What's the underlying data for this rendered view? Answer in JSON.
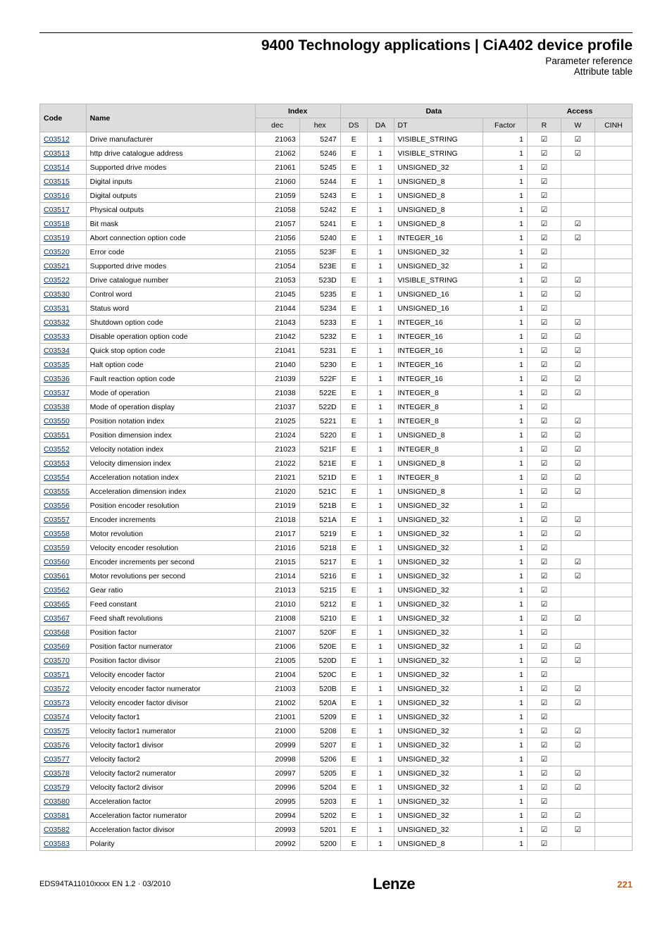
{
  "header": {
    "title": "9400 Technology applications | CiA402 device profile",
    "sub1": "Parameter reference",
    "sub2": "Attribute table"
  },
  "table": {
    "head": {
      "code": "Code",
      "name": "Name",
      "index_group": "Index",
      "data_group": "Data",
      "access_group": "Access",
      "dec": "dec",
      "hex": "hex",
      "ds": "DS",
      "da": "DA",
      "dt": "DT",
      "factor": "Factor",
      "r": "R",
      "w": "W",
      "cinh": "CINH"
    },
    "rows": [
      {
        "code": "C03512",
        "name": "Drive manufacturer",
        "dec": "21063",
        "hex": "5247",
        "ds": "E",
        "da": "1",
        "dt": "VISIBLE_STRING",
        "factor": "1",
        "r": true,
        "w": true,
        "cinh": false
      },
      {
        "code": "C03513",
        "name": "http drive catalogue address",
        "dec": "21062",
        "hex": "5246",
        "ds": "E",
        "da": "1",
        "dt": "VISIBLE_STRING",
        "factor": "1",
        "r": true,
        "w": true,
        "cinh": false
      },
      {
        "code": "C03514",
        "name": "Supported drive modes",
        "dec": "21061",
        "hex": "5245",
        "ds": "E",
        "da": "1",
        "dt": "UNSIGNED_32",
        "factor": "1",
        "r": true,
        "w": false,
        "cinh": false
      },
      {
        "code": "C03515",
        "name": "Digital inputs",
        "dec": "21060",
        "hex": "5244",
        "ds": "E",
        "da": "1",
        "dt": "UNSIGNED_8",
        "factor": "1",
        "r": true,
        "w": false,
        "cinh": false
      },
      {
        "code": "C03516",
        "name": "Digital outputs",
        "dec": "21059",
        "hex": "5243",
        "ds": "E",
        "da": "1",
        "dt": "UNSIGNED_8",
        "factor": "1",
        "r": true,
        "w": false,
        "cinh": false
      },
      {
        "code": "C03517",
        "name": "Physical outputs",
        "dec": "21058",
        "hex": "5242",
        "ds": "E",
        "da": "1",
        "dt": "UNSIGNED_8",
        "factor": "1",
        "r": true,
        "w": false,
        "cinh": false
      },
      {
        "code": "C03518",
        "name": "Bit mask",
        "dec": "21057",
        "hex": "5241",
        "ds": "E",
        "da": "1",
        "dt": "UNSIGNED_8",
        "factor": "1",
        "r": true,
        "w": true,
        "cinh": false
      },
      {
        "code": "C03519",
        "name": "Abort connection option code",
        "dec": "21056",
        "hex": "5240",
        "ds": "E",
        "da": "1",
        "dt": "INTEGER_16",
        "factor": "1",
        "r": true,
        "w": true,
        "cinh": false
      },
      {
        "code": "C03520",
        "name": "Error code",
        "dec": "21055",
        "hex": "523F",
        "ds": "E",
        "da": "1",
        "dt": "UNSIGNED_32",
        "factor": "1",
        "r": true,
        "w": false,
        "cinh": false
      },
      {
        "code": "C03521",
        "name": "Supported drive modes",
        "dec": "21054",
        "hex": "523E",
        "ds": "E",
        "da": "1",
        "dt": "UNSIGNED_32",
        "factor": "1",
        "r": true,
        "w": false,
        "cinh": false
      },
      {
        "code": "C03522",
        "name": "Drive catalogue number",
        "dec": "21053",
        "hex": "523D",
        "ds": "E",
        "da": "1",
        "dt": "VISIBLE_STRING",
        "factor": "1",
        "r": true,
        "w": true,
        "cinh": false
      },
      {
        "code": "C03530",
        "name": "Control word",
        "dec": "21045",
        "hex": "5235",
        "ds": "E",
        "da": "1",
        "dt": "UNSIGNED_16",
        "factor": "1",
        "r": true,
        "w": true,
        "cinh": false
      },
      {
        "code": "C03531",
        "name": "Status word",
        "dec": "21044",
        "hex": "5234",
        "ds": "E",
        "da": "1",
        "dt": "UNSIGNED_16",
        "factor": "1",
        "r": true,
        "w": false,
        "cinh": false
      },
      {
        "code": "C03532",
        "name": "Shutdown option code",
        "dec": "21043",
        "hex": "5233",
        "ds": "E",
        "da": "1",
        "dt": "INTEGER_16",
        "factor": "1",
        "r": true,
        "w": true,
        "cinh": false
      },
      {
        "code": "C03533",
        "name": "Disable operation option code",
        "dec": "21042",
        "hex": "5232",
        "ds": "E",
        "da": "1",
        "dt": "INTEGER_16",
        "factor": "1",
        "r": true,
        "w": true,
        "cinh": false
      },
      {
        "code": "C03534",
        "name": "Quick stop option code",
        "dec": "21041",
        "hex": "5231",
        "ds": "E",
        "da": "1",
        "dt": "INTEGER_16",
        "factor": "1",
        "r": true,
        "w": true,
        "cinh": false
      },
      {
        "code": "C03535",
        "name": "Halt option code",
        "dec": "21040",
        "hex": "5230",
        "ds": "E",
        "da": "1",
        "dt": "INTEGER_16",
        "factor": "1",
        "r": true,
        "w": true,
        "cinh": false
      },
      {
        "code": "C03536",
        "name": "Fault reaction option code",
        "dec": "21039",
        "hex": "522F",
        "ds": "E",
        "da": "1",
        "dt": "INTEGER_16",
        "factor": "1",
        "r": true,
        "w": true,
        "cinh": false
      },
      {
        "code": "C03537",
        "name": "Mode of operation",
        "dec": "21038",
        "hex": "522E",
        "ds": "E",
        "da": "1",
        "dt": "INTEGER_8",
        "factor": "1",
        "r": true,
        "w": true,
        "cinh": false
      },
      {
        "code": "C03538",
        "name": "Mode of operation display",
        "dec": "21037",
        "hex": "522D",
        "ds": "E",
        "da": "1",
        "dt": "INTEGER_8",
        "factor": "1",
        "r": true,
        "w": false,
        "cinh": false
      },
      {
        "code": "C03550",
        "name": "Position notation index",
        "dec": "21025",
        "hex": "5221",
        "ds": "E",
        "da": "1",
        "dt": "INTEGER_8",
        "factor": "1",
        "r": true,
        "w": true,
        "cinh": false
      },
      {
        "code": "C03551",
        "name": "Position dimension index",
        "dec": "21024",
        "hex": "5220",
        "ds": "E",
        "da": "1",
        "dt": "UNSIGNED_8",
        "factor": "1",
        "r": true,
        "w": true,
        "cinh": false
      },
      {
        "code": "C03552",
        "name": "Velocity notation index",
        "dec": "21023",
        "hex": "521F",
        "ds": "E",
        "da": "1",
        "dt": "INTEGER_8",
        "factor": "1",
        "r": true,
        "w": true,
        "cinh": false
      },
      {
        "code": "C03553",
        "name": "Velocity dimension index",
        "dec": "21022",
        "hex": "521E",
        "ds": "E",
        "da": "1",
        "dt": "UNSIGNED_8",
        "factor": "1",
        "r": true,
        "w": true,
        "cinh": false
      },
      {
        "code": "C03554",
        "name": "Acceleration notation index",
        "dec": "21021",
        "hex": "521D",
        "ds": "E",
        "da": "1",
        "dt": "INTEGER_8",
        "factor": "1",
        "r": true,
        "w": true,
        "cinh": false
      },
      {
        "code": "C03555",
        "name": "Acceleration dimension index",
        "dec": "21020",
        "hex": "521C",
        "ds": "E",
        "da": "1",
        "dt": "UNSIGNED_8",
        "factor": "1",
        "r": true,
        "w": true,
        "cinh": false
      },
      {
        "code": "C03556",
        "name": "Position encoder resolution",
        "dec": "21019",
        "hex": "521B",
        "ds": "E",
        "da": "1",
        "dt": "UNSIGNED_32",
        "factor": "1",
        "r": true,
        "w": false,
        "cinh": false
      },
      {
        "code": "C03557",
        "name": "Encoder increments",
        "dec": "21018",
        "hex": "521A",
        "ds": "E",
        "da": "1",
        "dt": "UNSIGNED_32",
        "factor": "1",
        "r": true,
        "w": true,
        "cinh": false
      },
      {
        "code": "C03558",
        "name": "Motor revolution",
        "dec": "21017",
        "hex": "5219",
        "ds": "E",
        "da": "1",
        "dt": "UNSIGNED_32",
        "factor": "1",
        "r": true,
        "w": true,
        "cinh": false
      },
      {
        "code": "C03559",
        "name": "Velocity encoder resolution",
        "dec": "21016",
        "hex": "5218",
        "ds": "E",
        "da": "1",
        "dt": "UNSIGNED_32",
        "factor": "1",
        "r": true,
        "w": false,
        "cinh": false
      },
      {
        "code": "C03560",
        "name": "Encoder increments per second",
        "dec": "21015",
        "hex": "5217",
        "ds": "E",
        "da": "1",
        "dt": "UNSIGNED_32",
        "factor": "1",
        "r": true,
        "w": true,
        "cinh": false
      },
      {
        "code": "C03561",
        "name": "Motor revolutions per second",
        "dec": "21014",
        "hex": "5216",
        "ds": "E",
        "da": "1",
        "dt": "UNSIGNED_32",
        "factor": "1",
        "r": true,
        "w": true,
        "cinh": false
      },
      {
        "code": "C03562",
        "name": "Gear ratio",
        "dec": "21013",
        "hex": "5215",
        "ds": "E",
        "da": "1",
        "dt": "UNSIGNED_32",
        "factor": "1",
        "r": true,
        "w": false,
        "cinh": false
      },
      {
        "code": "C03565",
        "name": "Feed constant",
        "dec": "21010",
        "hex": "5212",
        "ds": "E",
        "da": "1",
        "dt": "UNSIGNED_32",
        "factor": "1",
        "r": true,
        "w": false,
        "cinh": false
      },
      {
        "code": "C03567",
        "name": "Feed shaft revolutions",
        "dec": "21008",
        "hex": "5210",
        "ds": "E",
        "da": "1",
        "dt": "UNSIGNED_32",
        "factor": "1",
        "r": true,
        "w": true,
        "cinh": false
      },
      {
        "code": "C03568",
        "name": "Position factor",
        "dec": "21007",
        "hex": "520F",
        "ds": "E",
        "da": "1",
        "dt": "UNSIGNED_32",
        "factor": "1",
        "r": true,
        "w": false,
        "cinh": false
      },
      {
        "code": "C03569",
        "name": "Position factor numerator",
        "dec": "21006",
        "hex": "520E",
        "ds": "E",
        "da": "1",
        "dt": "UNSIGNED_32",
        "factor": "1",
        "r": true,
        "w": true,
        "cinh": false
      },
      {
        "code": "C03570",
        "name": "Position factor divisor",
        "dec": "21005",
        "hex": "520D",
        "ds": "E",
        "da": "1",
        "dt": "UNSIGNED_32",
        "factor": "1",
        "r": true,
        "w": true,
        "cinh": false
      },
      {
        "code": "C03571",
        "name": "Velocity encoder factor",
        "dec": "21004",
        "hex": "520C",
        "ds": "E",
        "da": "1",
        "dt": "UNSIGNED_32",
        "factor": "1",
        "r": true,
        "w": false,
        "cinh": false
      },
      {
        "code": "C03572",
        "name": "Velocity encoder factor numerator",
        "dec": "21003",
        "hex": "520B",
        "ds": "E",
        "da": "1",
        "dt": "UNSIGNED_32",
        "factor": "1",
        "r": true,
        "w": true,
        "cinh": false
      },
      {
        "code": "C03573",
        "name": "Velocity encoder factor divisor",
        "dec": "21002",
        "hex": "520A",
        "ds": "E",
        "da": "1",
        "dt": "UNSIGNED_32",
        "factor": "1",
        "r": true,
        "w": true,
        "cinh": false
      },
      {
        "code": "C03574",
        "name": "Velocity factor1",
        "dec": "21001",
        "hex": "5209",
        "ds": "E",
        "da": "1",
        "dt": "UNSIGNED_32",
        "factor": "1",
        "r": true,
        "w": false,
        "cinh": false
      },
      {
        "code": "C03575",
        "name": "Velocity factor1 numerator",
        "dec": "21000",
        "hex": "5208",
        "ds": "E",
        "da": "1",
        "dt": "UNSIGNED_32",
        "factor": "1",
        "r": true,
        "w": true,
        "cinh": false
      },
      {
        "code": "C03576",
        "name": "Velocity factor1 divisor",
        "dec": "20999",
        "hex": "5207",
        "ds": "E",
        "da": "1",
        "dt": "UNSIGNED_32",
        "factor": "1",
        "r": true,
        "w": true,
        "cinh": false
      },
      {
        "code": "C03577",
        "name": "Velocity factor2",
        "dec": "20998",
        "hex": "5206",
        "ds": "E",
        "da": "1",
        "dt": "UNSIGNED_32",
        "factor": "1",
        "r": true,
        "w": false,
        "cinh": false
      },
      {
        "code": "C03578",
        "name": "Velocity factor2 numerator",
        "dec": "20997",
        "hex": "5205",
        "ds": "E",
        "da": "1",
        "dt": "UNSIGNED_32",
        "factor": "1",
        "r": true,
        "w": true,
        "cinh": false
      },
      {
        "code": "C03579",
        "name": "Velocity factor2 divisor",
        "dec": "20996",
        "hex": "5204",
        "ds": "E",
        "da": "1",
        "dt": "UNSIGNED_32",
        "factor": "1",
        "r": true,
        "w": true,
        "cinh": false
      },
      {
        "code": "C03580",
        "name": "Acceleration factor",
        "dec": "20995",
        "hex": "5203",
        "ds": "E",
        "da": "1",
        "dt": "UNSIGNED_32",
        "factor": "1",
        "r": true,
        "w": false,
        "cinh": false
      },
      {
        "code": "C03581",
        "name": "Acceleration factor numerator",
        "dec": "20994",
        "hex": "5202",
        "ds": "E",
        "da": "1",
        "dt": "UNSIGNED_32",
        "factor": "1",
        "r": true,
        "w": true,
        "cinh": false
      },
      {
        "code": "C03582",
        "name": "Acceleration factor divisor",
        "dec": "20993",
        "hex": "5201",
        "ds": "E",
        "da": "1",
        "dt": "UNSIGNED_32",
        "factor": "1",
        "r": true,
        "w": true,
        "cinh": false
      },
      {
        "code": "C03583",
        "name": "Polarity",
        "dec": "20992",
        "hex": "5200",
        "ds": "E",
        "da": "1",
        "dt": "UNSIGNED_8",
        "factor": "1",
        "r": true,
        "w": false,
        "cinh": false
      }
    ]
  },
  "footer": {
    "doc_id": "EDS94TA11010xxxx EN 1.2 · 03/2010",
    "logo": "Lenze",
    "page": "221"
  },
  "glyphs": {
    "check": "☑"
  }
}
